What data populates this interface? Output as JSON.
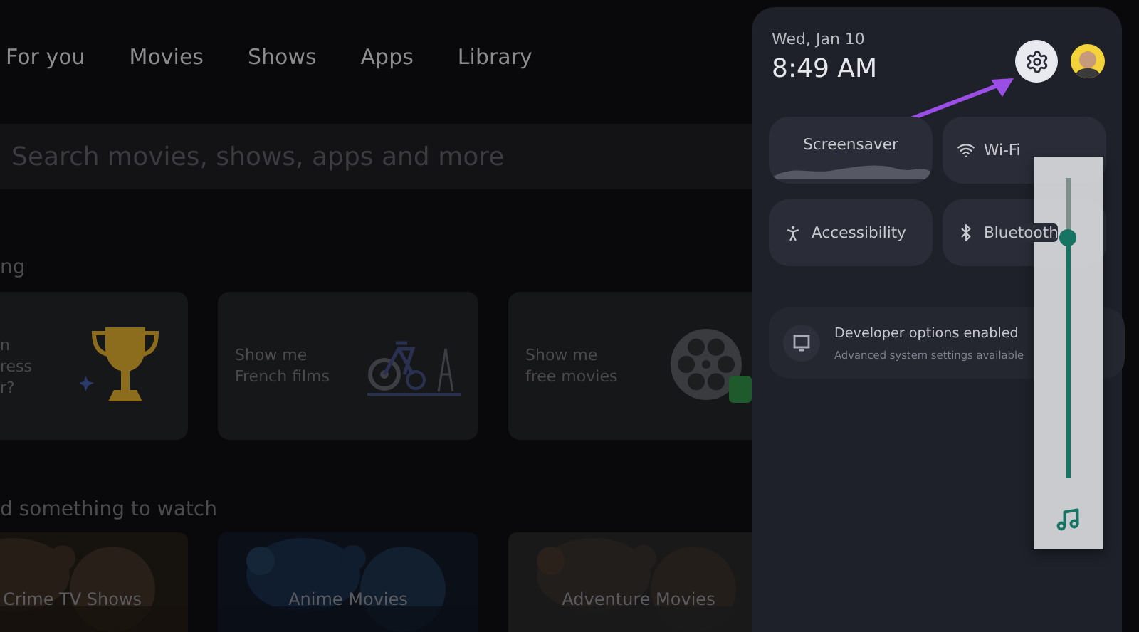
{
  "nav_tabs": [
    {
      "label": "For you",
      "selected": false
    },
    {
      "label": "Movies",
      "selected": false
    },
    {
      "label": "Shows",
      "selected": false
    },
    {
      "label": "Apps",
      "selected": false
    },
    {
      "label": "Library",
      "selected": false
    }
  ],
  "search": {
    "placeholder": "Search movies, shows, apps and more"
  },
  "suggestions": {
    "heading": "ng",
    "cards": [
      {
        "kind": "trophy",
        "lines": [
          "n",
          "ress",
          "r?"
        ]
      },
      {
        "kind": "bicycle",
        "lines": [
          "Show me",
          "French films"
        ]
      },
      {
        "kind": "film-reel",
        "lines": [
          "Show me",
          "free movies"
        ]
      }
    ]
  },
  "browse": {
    "heading": "d something to watch",
    "tiles": [
      {
        "label": "Crime TV Shows"
      },
      {
        "label": "Anime Movies"
      },
      {
        "label": "Adventure Movies"
      }
    ]
  },
  "quick_settings": {
    "date": "Wed, Jan 10",
    "time": "8:49 AM",
    "tiles": [
      {
        "label": "Screensaver",
        "kind": "screensaver"
      },
      {
        "label": "Wi-Fi",
        "kind": "wifi"
      },
      {
        "label": "Accessibility",
        "kind": "accessibility"
      },
      {
        "label": "Bluetooth",
        "kind": "bluetooth"
      }
    ],
    "notification": {
      "title": "Developer options enabled",
      "subtitle": "Advanced system settings available"
    },
    "volume": {
      "level": 0.8
    }
  }
}
